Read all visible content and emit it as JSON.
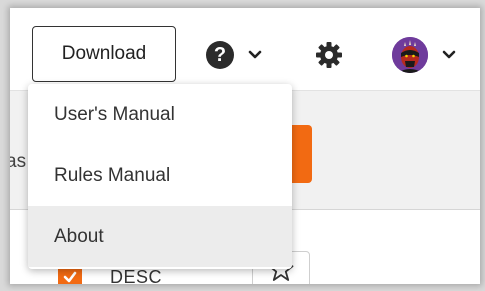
{
  "toolbar": {
    "download_label": "Download",
    "help_glyph": "?"
  },
  "background": {
    "partial_text": "as",
    "row_label": "DESC"
  },
  "dropdown": {
    "items": [
      {
        "label": "User's Manual"
      },
      {
        "label": "Rules Manual"
      },
      {
        "label": "About"
      }
    ]
  },
  "icons": {
    "help": "question-circle-icon",
    "settings": "gear-icon",
    "avatar": "user-avatar",
    "chevron": "chevron-down-icon",
    "star": "star-outline-icon",
    "checkbox": "checkbox-checked-icon"
  },
  "colors": {
    "accent": "#f26a12",
    "avatar_bg": "#6f3b9c",
    "dark": "#2b2b2b"
  }
}
